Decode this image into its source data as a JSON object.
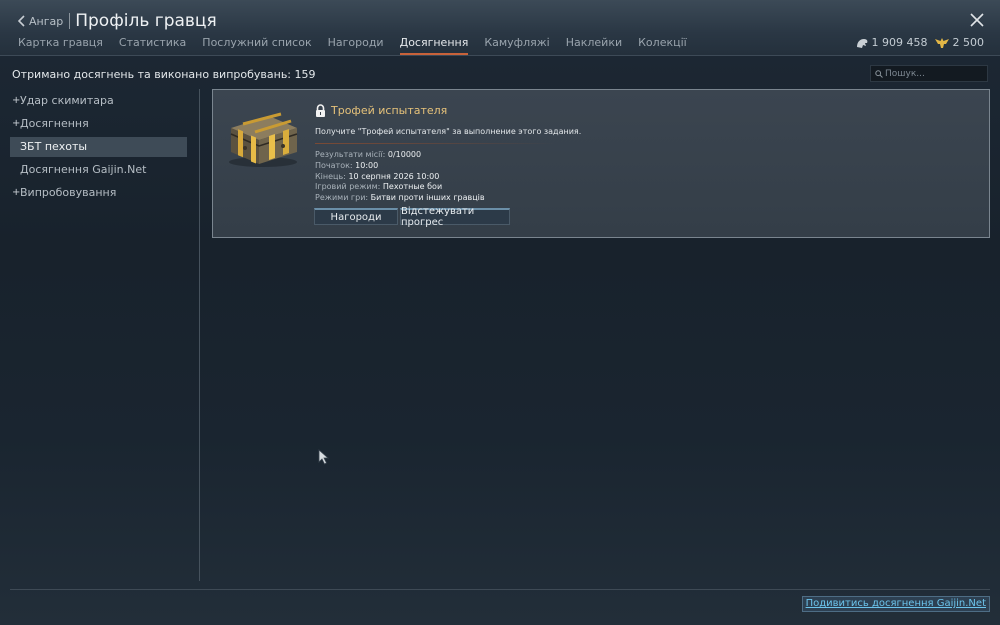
{
  "header": {
    "back_label": "Ангар",
    "title": "Профіль гравця",
    "tabs": [
      {
        "label": "Картка гравця",
        "active": false
      },
      {
        "label": "Статистика",
        "active": false
      },
      {
        "label": "Послужний список",
        "active": false
      },
      {
        "label": "Нагороди",
        "active": false
      },
      {
        "label": "Досягнення",
        "active": true
      },
      {
        "label": "Камуфляжі",
        "active": false
      },
      {
        "label": "Наклейки",
        "active": false
      },
      {
        "label": "Колекції",
        "active": false
      }
    ],
    "silver_lions": "1 909 458",
    "golden_eagles": "2 500"
  },
  "summary": "Отримано досягнень та виконано випробувань: 159",
  "search": {
    "placeholder": "Пошук..."
  },
  "sidebar": {
    "items": [
      {
        "label": "Удар скимитара",
        "prefix": "+"
      },
      {
        "label": "Досягнення",
        "prefix": "+"
      },
      {
        "label": "ЗБТ пехоты",
        "prefix": "",
        "selected": true
      },
      {
        "label": "Досягнення Gaijin.Net",
        "prefix": ""
      },
      {
        "label": "Випробовування",
        "prefix": "+"
      }
    ]
  },
  "card": {
    "title": "Трофей испытателя",
    "description": "Получите \"Трофей испытателя\" за выполнение этого задания.",
    "results_label": "Результати місії:",
    "results_value": "0/10000",
    "start_label": "Початок:",
    "start_value": "10:00",
    "end_label": "Кінець:",
    "end_value": "10 серпня 2026 10:00",
    "game_mode_label": "Ігровий режим:",
    "game_mode_value": "Пехотные бои",
    "game_modes_label": "Режими гри:",
    "game_modes_value": "Битви проти інших гравців",
    "rewards_button": "Нагороди",
    "track_button": "Відстежувати прогрес"
  },
  "footer": {
    "gaijin_link": "Подивитись досягнення Gaijin.Net"
  },
  "colors": {
    "accent_tab": "#c8623a",
    "title_gold": "#e6c27a",
    "link_blue": "#6cc4ec"
  }
}
